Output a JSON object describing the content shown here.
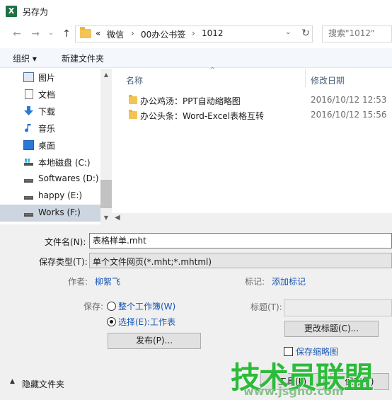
{
  "window": {
    "title": "另存为",
    "app_icon": "excel-icon"
  },
  "nav": {
    "back_icon": "←",
    "forward_icon": "→",
    "recent_icon": "⌄",
    "up_icon": "↑",
    "breadcrumb": [
      "«",
      "微信",
      "00办公书签",
      "1012"
    ],
    "separator": "›",
    "dropdown_icon": "⌄",
    "refresh_icon": "↻",
    "search_placeholder": "搜索\"1012\""
  },
  "toolbar": {
    "organize_label": "组织 ▾",
    "new_folder_label": "新建文件夹"
  },
  "sidebar": {
    "items": [
      {
        "label": "图片",
        "icon": "pictures-icon"
      },
      {
        "label": "文档",
        "icon": "documents-icon"
      },
      {
        "label": "下载",
        "icon": "downloads-icon"
      },
      {
        "label": "音乐",
        "icon": "music-icon"
      },
      {
        "label": "桌面",
        "icon": "desktop-icon"
      },
      {
        "label": "本地磁盘 (C:)",
        "icon": "system-drive-icon"
      },
      {
        "label": "Softwares (D:)",
        "icon": "drive-icon"
      },
      {
        "label": "happy (E:)",
        "icon": "drive-icon"
      },
      {
        "label": "Works (F:)",
        "icon": "drive-icon",
        "selected": true
      }
    ]
  },
  "filelist": {
    "columns": {
      "name": "名称",
      "date": "修改日期"
    },
    "sort_indicator": "^",
    "rows": [
      {
        "name": "办公鸡汤：PPT自动缩略图",
        "date": "2016/10/12 12:53"
      },
      {
        "name": "办公头条：Word-Excel表格互转",
        "date": "2016/10/12 15:56"
      }
    ]
  },
  "form": {
    "filename_label": "文件名(N):",
    "filename_value": "表格样单.mht",
    "type_label": "保存类型(T):",
    "type_value": "单个文件网页(*.mht;*.mhtml)",
    "author_label": "作者:",
    "author_value": "柳絮飞",
    "tags_label": "标记:",
    "tags_value": "添加标记",
    "save_label": "保存:",
    "radio_workbook": "整个工作簿(W)",
    "radio_selection": "选择(E):工作表",
    "publish_button": "发布(P)...",
    "title_label": "标题(T):",
    "change_title_button": "更改标题(C)...",
    "thumbnail_label": "保存缩略图",
    "hide_folders_label": "隐藏文件夹",
    "tools_button": "工具(L)",
    "save_button": "保存(S)"
  },
  "watermark": {
    "text": "技术员联盟",
    "url": "www.jsgho.com"
  }
}
